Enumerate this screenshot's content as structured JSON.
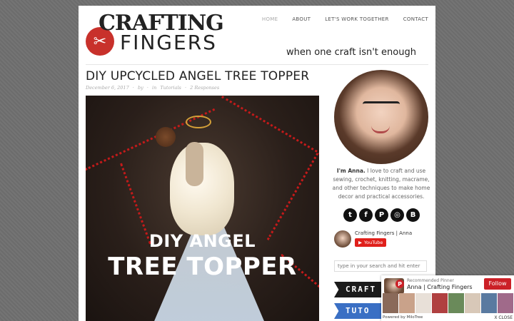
{
  "header": {
    "logo_top": "CRAFTING",
    "logo_bottom": "FINGERS",
    "tagline": "when one craft isn't enough",
    "nav": [
      {
        "label": "HOME",
        "active": true
      },
      {
        "label": "ABOUT",
        "active": false
      },
      {
        "label": "LET'S WORK TOGETHER",
        "active": false
      },
      {
        "label": "CONTACT",
        "active": false
      }
    ]
  },
  "post": {
    "title": "DIY UPCYCLED ANGEL TREE TOPPER",
    "date": "December 6, 2017",
    "by": "by",
    "in": "in",
    "category": "Tutorials",
    "responses": "2 Responses",
    "hero_line1": "DIY ANGEL",
    "hero_line2": "TREE TOPPER"
  },
  "sidebar": {
    "bio_name": "I'm Anna.",
    "bio_text": "I love to craft and use sewing, crochet, knitting, macrame, and other techniques to make home decor and practical accessories.",
    "socials": [
      {
        "icon": "twitter-icon",
        "glyph": "t"
      },
      {
        "icon": "facebook-icon",
        "glyph": "f"
      },
      {
        "icon": "pinterest-icon",
        "glyph": "P"
      },
      {
        "icon": "instagram-icon",
        "glyph": "◎"
      },
      {
        "icon": "bloglovin-icon",
        "glyph": "B"
      }
    ],
    "youtube": {
      "channel": "Crafting Fingers | Anna",
      "button": "YouTube"
    },
    "search_placeholder": "type in your search and hit enter",
    "ribbon1": "CRAFT",
    "ribbon2": "TUTO"
  },
  "pinterest_popup": {
    "subtitle": "Recommended Pinner",
    "name": "Anna | Crafting Fingers",
    "follow": "Follow",
    "powered": "Powered by MiloTree",
    "close": "X CLOSE"
  },
  "colors": {
    "brand_red": "#c8312b",
    "pinterest_red": "#cb2027",
    "youtube_red": "#e0201b",
    "ribbon_blue": "#3a6fc4"
  }
}
